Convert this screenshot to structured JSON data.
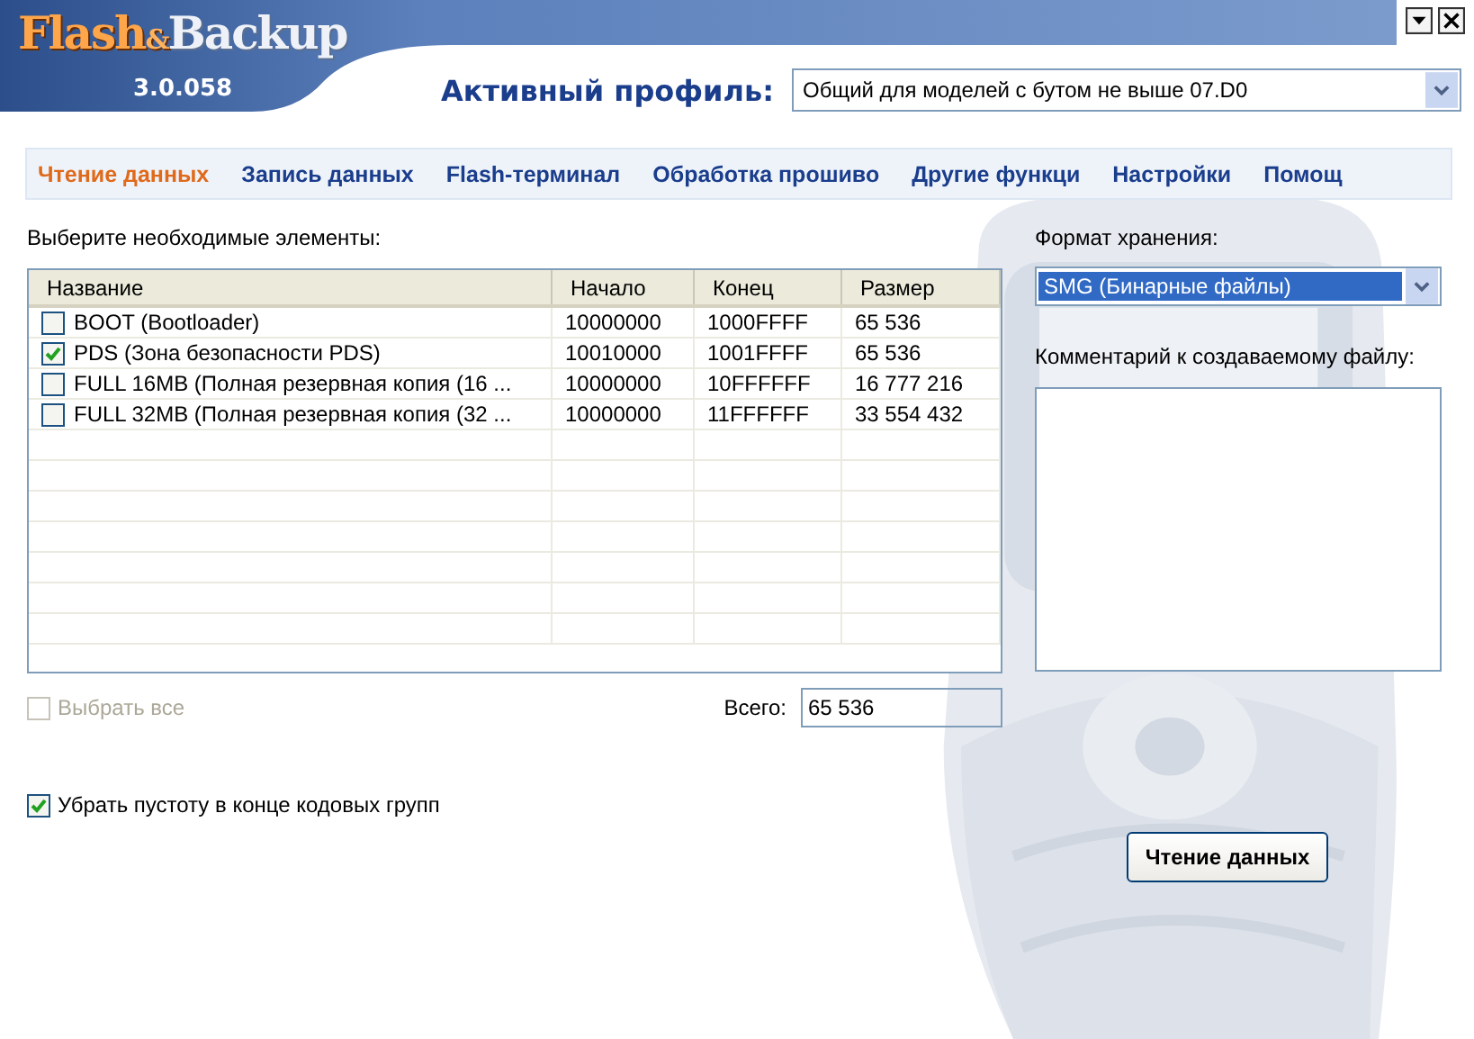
{
  "app": {
    "logo": [
      {
        "kind": "main",
        "text": "Flash"
      },
      {
        "kind": "amp",
        "text": "&"
      },
      {
        "kind": "alt",
        "text": "Backup"
      }
    ],
    "version": "3.0.058"
  },
  "profile": {
    "label": "Активный профиль:",
    "value": "Общий для моделей с бутом не выше 07.D0"
  },
  "tabs": [
    {
      "label": "Чтение данных",
      "selected": true
    },
    {
      "label": "Запись данных",
      "selected": false
    },
    {
      "label": "Flash-терминал",
      "selected": false
    },
    {
      "label": "Обработка прошиво",
      "selected": false
    },
    {
      "label": "Другие функци",
      "selected": false
    },
    {
      "label": "Настройки",
      "selected": false
    },
    {
      "label": "Помощ",
      "selected": false
    }
  ],
  "elements_label": "Выберите необходимые элементы:",
  "table": {
    "columns": [
      "Название",
      "Начало",
      "Конец",
      "Размер"
    ],
    "rows": [
      {
        "checked": false,
        "cells": [
          "BOOT (Bootloader)",
          "10000000",
          "1000FFFF",
          "65 536"
        ]
      },
      {
        "checked": true,
        "cells": [
          "PDS (Зона безопасности PDS)",
          "10010000",
          "1001FFFF",
          "65 536"
        ]
      },
      {
        "checked": false,
        "cells": [
          "FULL 16MB (Полная резервная копия (16 ...",
          "10000000",
          "10FFFFFF",
          "16 777 216"
        ]
      },
      {
        "checked": false,
        "cells": [
          "FULL 32MB (Полная резервная копия (32 ...",
          "10000000",
          "11FFFFFF",
          "33 554 432"
        ]
      }
    ]
  },
  "select_all": {
    "label": "Выбрать все",
    "checked": false,
    "disabled": true
  },
  "total": {
    "label": "Всего:",
    "value": "65 536"
  },
  "trim": {
    "label": "Убрать пустоту в конце кодовых групп",
    "checked": true,
    "disabled": false
  },
  "format": {
    "label": "Формат хранения:",
    "value": "SMG (Бинарные файлы)"
  },
  "comment": {
    "label": "Комментарий к создаваемому файлу:"
  },
  "read_button": {
    "label": "Чтение данных"
  }
}
